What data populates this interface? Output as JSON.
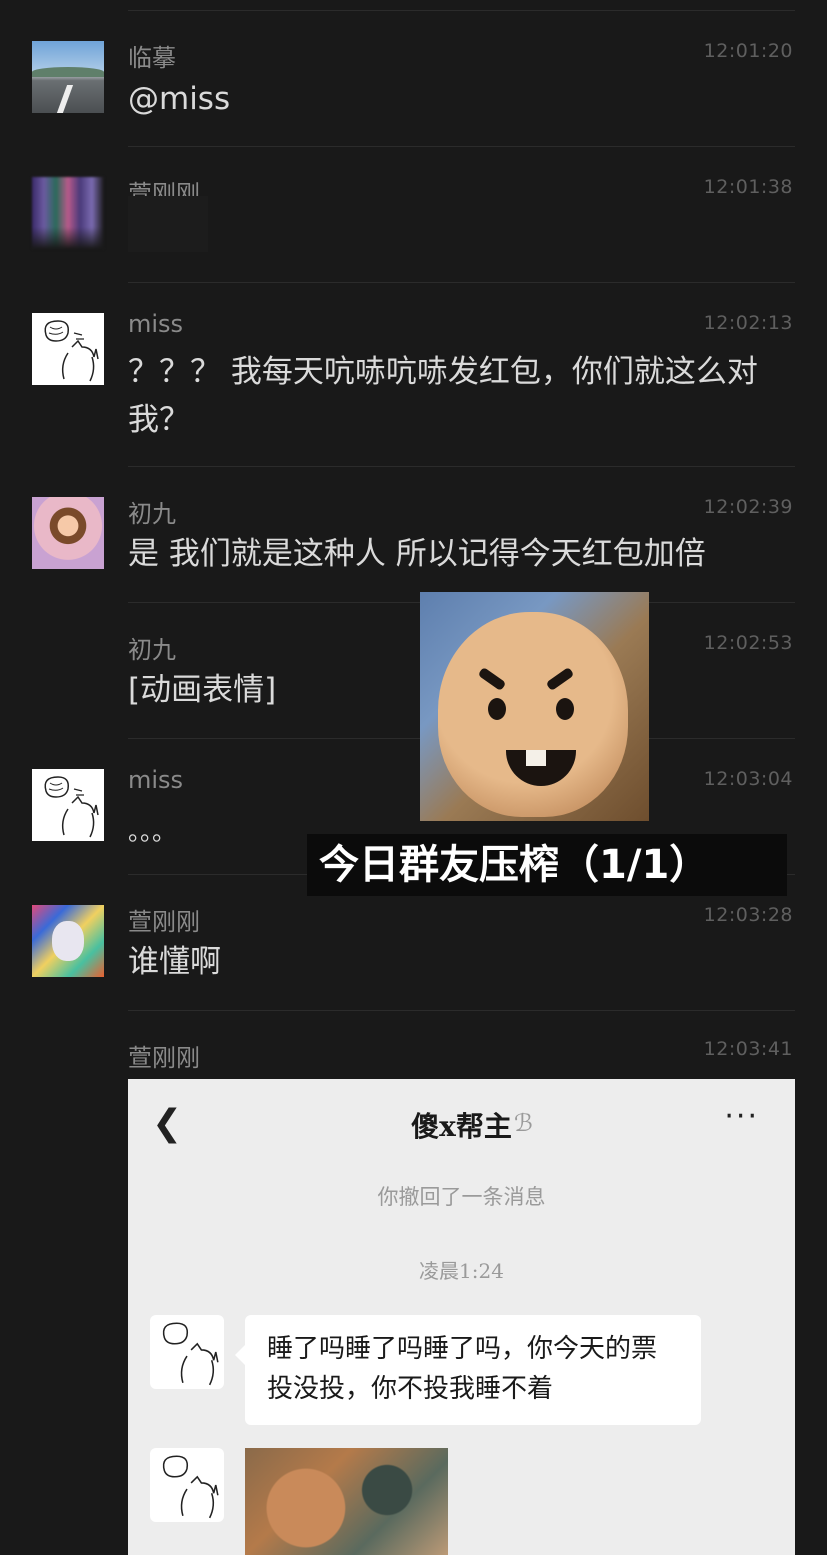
{
  "messages": [
    {
      "name": "临摹",
      "time": "12:01:20",
      "text": "@miss"
    },
    {
      "name": "萱刚刚",
      "time": "12:01:38",
      "text": ""
    },
    {
      "name": "miss",
      "time": "12:02:13",
      "text": "？？？ 我每天吭哧吭哧发红包，你们就这么对我？"
    },
    {
      "name": "初九",
      "time": "12:02:39",
      "text": "是 我们就是这种人 所以记得今天红包加倍"
    },
    {
      "name": "初九",
      "time": "12:02:53",
      "text": "[动画表情]"
    },
    {
      "name": "miss",
      "time": "12:03:04",
      "text": "。。。"
    },
    {
      "name": "萱刚刚",
      "time": "12:03:28",
      "text": "谁懂啊"
    },
    {
      "name": "萱刚刚",
      "time": "12:03:41",
      "text": ""
    }
  ],
  "sticker_caption": "今日群友压榨（1/1）",
  "embedded_chat": {
    "back_icon": "chevron-left-icon",
    "title": "傻x帮主",
    "ear_icon": "ear-icon",
    "more_icon": "more-dots-icon",
    "more_label": "···",
    "recall_notice": "你撤回了一条消息",
    "timestamp": "凌晨1:24",
    "bubble_text": "睡了吗睡了吗睡了吗，你今天的票投没投，你不投我睡不着"
  }
}
